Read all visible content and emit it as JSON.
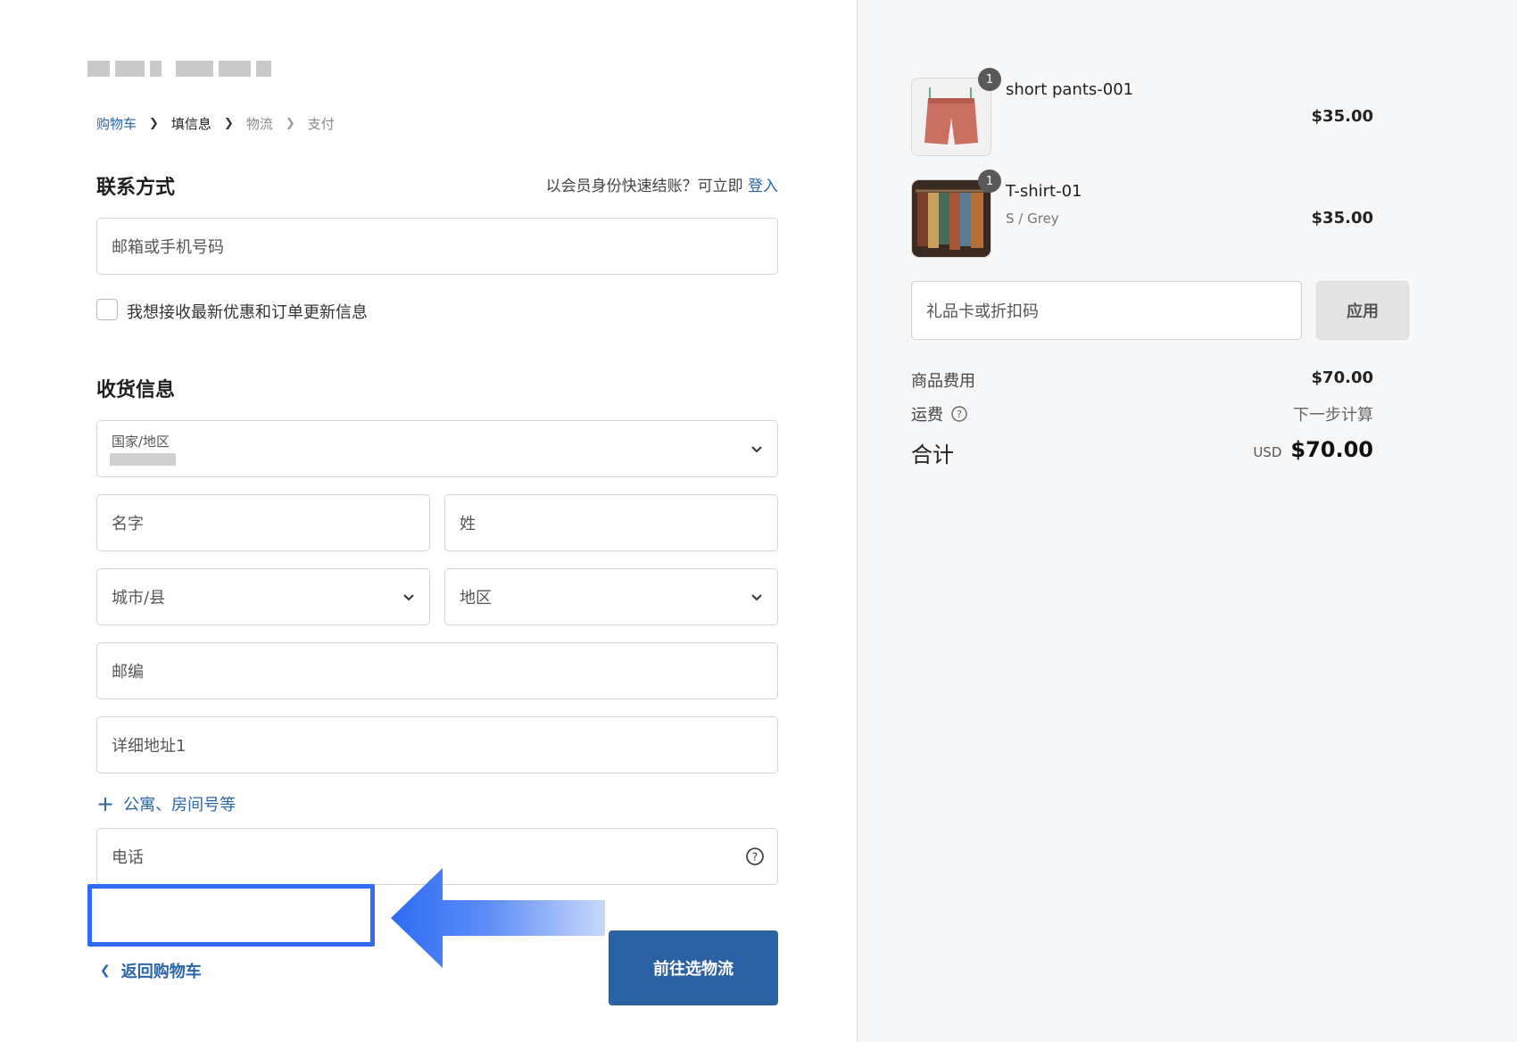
{
  "breadcrumb": {
    "cart": "购物车",
    "info": "填信息",
    "shipping": "物流",
    "payment": "支付"
  },
  "contact": {
    "title": "联系方式",
    "member_prompt": "以会员身份快速结账？可立即",
    "login_link": "登入",
    "email_placeholder": "邮箱或手机号码",
    "newsletter_label": "我想接收最新优惠和订单更新信息"
  },
  "shipping": {
    "title": "收货信息",
    "country_label": "国家/地区",
    "first_name": "名字",
    "last_name": "姓",
    "city": "城市/县",
    "region": "地区",
    "postal": "邮编",
    "address1": "详细地址1",
    "add_address2": "公寓、房间号等",
    "phone": "电话"
  },
  "actions": {
    "back": "返回购物车",
    "next": "前往选物流"
  },
  "cart": {
    "items": [
      {
        "name": "short pants-001",
        "variant": "",
        "qty": "1",
        "price": "$35.00"
      },
      {
        "name": "T-shirt-01",
        "variant": "S / Grey",
        "qty": "1",
        "price": "$35.00"
      }
    ],
    "gift_placeholder": "礼品卡或折扣码",
    "apply_label": "应用",
    "subtotal_label": "商品费用",
    "subtotal_value": "$70.00",
    "shipping_label": "运费",
    "shipping_value": "下一步计算",
    "total_label": "合计",
    "currency": "USD",
    "total_value": "$70.00"
  },
  "colors": {
    "accent": "#2a65a8",
    "button": "#2a62a4",
    "highlight": "#2d6cf4"
  }
}
